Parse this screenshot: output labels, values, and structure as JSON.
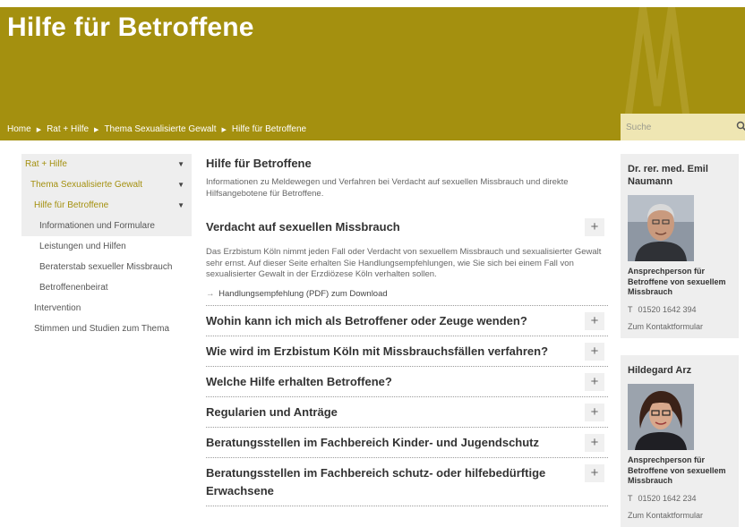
{
  "page": {
    "heading": "Hilfe für Betroffene",
    "accent_color": "#a4900f"
  },
  "breadcrumb": [
    "Home",
    "Rat + Hilfe",
    "Thema Sexualisierte Gewalt",
    "Hilfe für Betroffene"
  ],
  "search": {
    "placeholder": "Suche",
    "icon": "search-icon"
  },
  "nav": {
    "level1": "Rat + Hilfe",
    "level2": "Thema Sexualisierte Gewalt",
    "level3": "Hilfe für Betroffene",
    "subitems": [
      "Informationen und Formulare",
      "Leistungen und Hilfen",
      "Beraterstab sexueller Missbrauch",
      "Betroffenenbeirat"
    ],
    "others": [
      "Intervention",
      "Stimmen und Studien zum Thema"
    ]
  },
  "main": {
    "title": "Hilfe für Betroffene",
    "intro": "Informationen zu Meldewegen und Verfahren bei Verdacht auf sexuellen Missbrauch und direkte Hilfsangebotene für Betroffene.",
    "expanded": {
      "title": "Verdacht auf sexuellen Missbrauch",
      "body": "Das Erzbistum Köln nimmt jeden Fall oder Verdacht von sexuellem Missbrauch und sexualisierter Gewalt sehr ernst. Auf dieser Seite erhalten Sie Handlungsempfehlungen, wie Sie sich bei einem Fall von sexualisierter Gewalt in der Erzdiözese Köln verhalten sollen.",
      "link": "Handlungsempfehlung (PDF) zum Download"
    },
    "accordions": [
      "Wohin kann ich mich als Betroffener oder Zeuge wenden?",
      "Wie wird im Erzbistum Köln mit Missbrauchsfällen verfahren?",
      "Welche Hilfe erhalten Betroffene?",
      "Regularien und Anträge",
      "Beratungsstellen im Fachbereich Kinder- und Jugendschutz",
      "Beratungsstellen im Fachbereich schutz- oder hilfebedürftige Erwachsene"
    ],
    "plus": "+"
  },
  "contacts": [
    {
      "name": "Dr. rer. med. Emil Naumann",
      "role": "Ansprechperson für Betroffene von sexuellem Missbrauch",
      "phone_label": "T",
      "phone": "01520 1642 394",
      "link": "Zum Kontaktformular"
    },
    {
      "name": "Hildegard Arz",
      "role": "Ansprechperson für Betroffene von sexuellem Missbrauch",
      "phone_label": "T",
      "phone": "01520 1642 234",
      "link": "Zum Kontaktformular"
    }
  ]
}
